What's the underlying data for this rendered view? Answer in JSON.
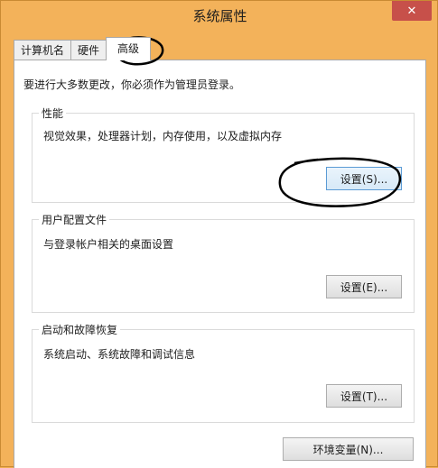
{
  "window": {
    "title": "系统属性",
    "close_label": "✕"
  },
  "tabs": [
    {
      "label": "计算机名"
    },
    {
      "label": "硬件"
    },
    {
      "label": "高级",
      "active": true
    }
  ],
  "admin_note": "要进行大多数更改，你必须作为管理员登录。",
  "groups": {
    "performance": {
      "title": "性能",
      "desc": "视觉效果，处理器计划，内存使用，以及虚拟内存",
      "button": "设置(S)..."
    },
    "profiles": {
      "title": "用户配置文件",
      "desc": "与登录帐户相关的桌面设置",
      "button": "设置(E)..."
    },
    "startup": {
      "title": "启动和故障恢复",
      "desc": "系统启动、系统故障和调试信息",
      "button": "设置(T)..."
    }
  },
  "env_button": "环境变量(N)...",
  "colors": {
    "titlebar": "#f3b25a",
    "close_button": "#c7504a",
    "annotation": "#000000"
  }
}
